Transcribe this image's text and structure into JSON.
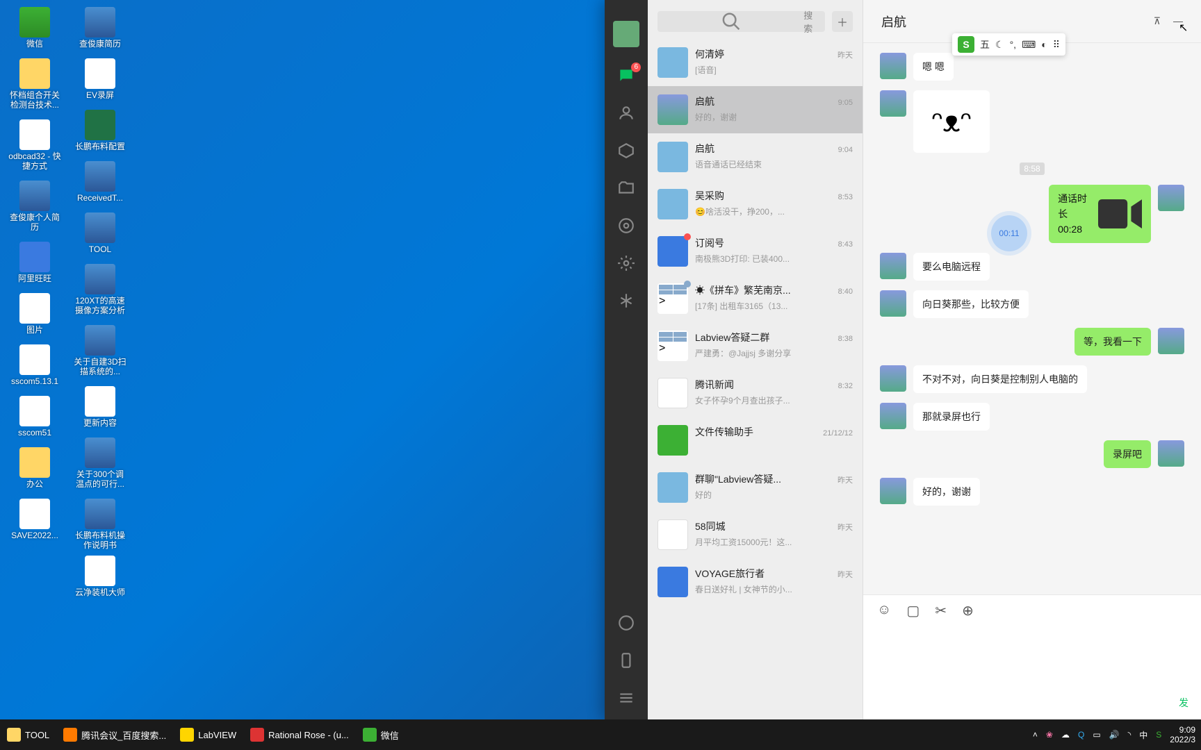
{
  "desktop_icons_col1": [
    {
      "l": "微信",
      "c": "ic-wc"
    },
    {
      "l": "怀档组合开关检测台技术...",
      "c": "ic-folder"
    },
    {
      "l": "odbcad32 - 快捷方式",
      "c": ""
    },
    {
      "l": "查俊康个人简历",
      "c": "ic-doc"
    },
    {
      "l": "阿里旺旺",
      "c": "ic-blue"
    },
    {
      "l": "图片",
      "c": ""
    },
    {
      "l": "sscom5.13.1",
      "c": ""
    },
    {
      "l": "sscom51",
      "c": ""
    },
    {
      "l": "办公",
      "c": "ic-folder"
    },
    {
      "l": "SAVE2022...",
      "c": ""
    }
  ],
  "desktop_icons_col2": [
    {
      "l": "查俊康简历",
      "c": "ic-doc"
    },
    {
      "l": "EV录屏",
      "c": ""
    },
    {
      "l": "长鹏布料配置",
      "c": "ic-xl"
    },
    {
      "l": "ReceivedT...",
      "c": "ic-doc"
    },
    {
      "l": "TOOL",
      "c": "ic-doc"
    },
    {
      "l": "120XT的高速摄像方案分析",
      "c": "ic-doc"
    },
    {
      "l": "关于自建3D扫描系统的...",
      "c": "ic-doc"
    },
    {
      "l": "更新内容",
      "c": ""
    },
    {
      "l": "关于300个调温点的可行...",
      "c": "ic-doc"
    },
    {
      "l": "长鹏布料机操作说明书",
      "c": "ic-doc"
    }
  ],
  "desktop_icons_col3": [
    {
      "l": "云净装机大师",
      "c": ""
    }
  ],
  "taskbar": {
    "items": [
      {
        "l": "TOOL",
        "c": "#ffd666"
      },
      {
        "l": "腾讯会议_百度搜索...",
        "c": "#ff7a00"
      },
      {
        "l": "LabVIEW",
        "c": "#ffd500"
      },
      {
        "l": "Rational Rose - (u...",
        "c": "#d33"
      },
      {
        "l": "微信",
        "c": "#3cb034"
      }
    ],
    "ime": "中",
    "time": "9:09",
    "date": "2022/3"
  },
  "wechat": {
    "search_ph": "搜索",
    "nav_badge": "6",
    "convs": [
      {
        "nm": "何清婷",
        "msg": "[语音]",
        "tm": "昨天",
        "av": "p"
      },
      {
        "nm": "启航",
        "msg": "好的，谢谢",
        "tm": "9:05",
        "av": "s",
        "sel": true
      },
      {
        "nm": "启航",
        "msg": "语音通话已经结束",
        "tm": "9:04",
        "av": "p"
      },
      {
        "nm": "吴采购",
        "msg": "😊啥活没干，挣200，...",
        "tm": "8:53",
        "av": "p"
      },
      {
        "nm": "订阅号",
        "msg": "南极熊3D打印: 已装400...",
        "tm": "8:43",
        "av": "b",
        "rd": true
      },
      {
        "nm": "☀《拼车》繁芜南京...",
        "msg": "[17条] 出租车3165（13...",
        "tm": "8:40",
        "av": "g",
        "rd": true
      },
      {
        "nm": "Labview答疑二群",
        "msg": "严建勇：@Jajjsj 多谢分享",
        "tm": "8:38",
        "av": "g"
      },
      {
        "nm": "腾讯新闻",
        "msg": "女子怀孕9个月查出孩子...",
        "tm": "8:32",
        "av": "w"
      },
      {
        "nm": "文件传输助手",
        "msg": "",
        "tm": "21/12/12",
        "av": "gr"
      },
      {
        "nm": "群聊\"Labview答疑...",
        "msg": "好的",
        "tm": "昨天",
        "av": "p"
      },
      {
        "nm": "58同城",
        "msg": "月平均工资15000元！这...",
        "tm": "昨天",
        "av": "w"
      },
      {
        "nm": "VOYAGE旅行者",
        "msg": "春日送好礼 | 女神节的小...",
        "tm": "昨天",
        "av": "b"
      }
    ],
    "chat": {
      "title": "启航",
      "messages": [
        {
          "who": "them",
          "type": "text",
          "txt": "嗯 嗯"
        },
        {
          "who": "them",
          "type": "sticker"
        },
        {
          "type": "time",
          "txt": "8:58"
        },
        {
          "who": "me",
          "type": "call",
          "txt": "通话时长 00:28"
        },
        {
          "who": "them",
          "type": "text",
          "txt": "要么电脑远程"
        },
        {
          "who": "them",
          "type": "text",
          "txt": "向日葵那些，比较方便"
        },
        {
          "who": "me",
          "type": "text",
          "txt": "等，我看一下"
        },
        {
          "who": "them",
          "type": "text",
          "txt": "不对不对，向日葵是控制别人电脑的"
        },
        {
          "who": "them",
          "type": "text",
          "txt": "那就录屏也行"
        },
        {
          "who": "me",
          "type": "text",
          "txt": "录屏吧"
        },
        {
          "who": "them",
          "type": "text",
          "txt": "好的，谢谢"
        }
      ],
      "voice_bubble": "00:11",
      "send": "发"
    }
  },
  "ime_bar": {
    "mode": "五"
  }
}
